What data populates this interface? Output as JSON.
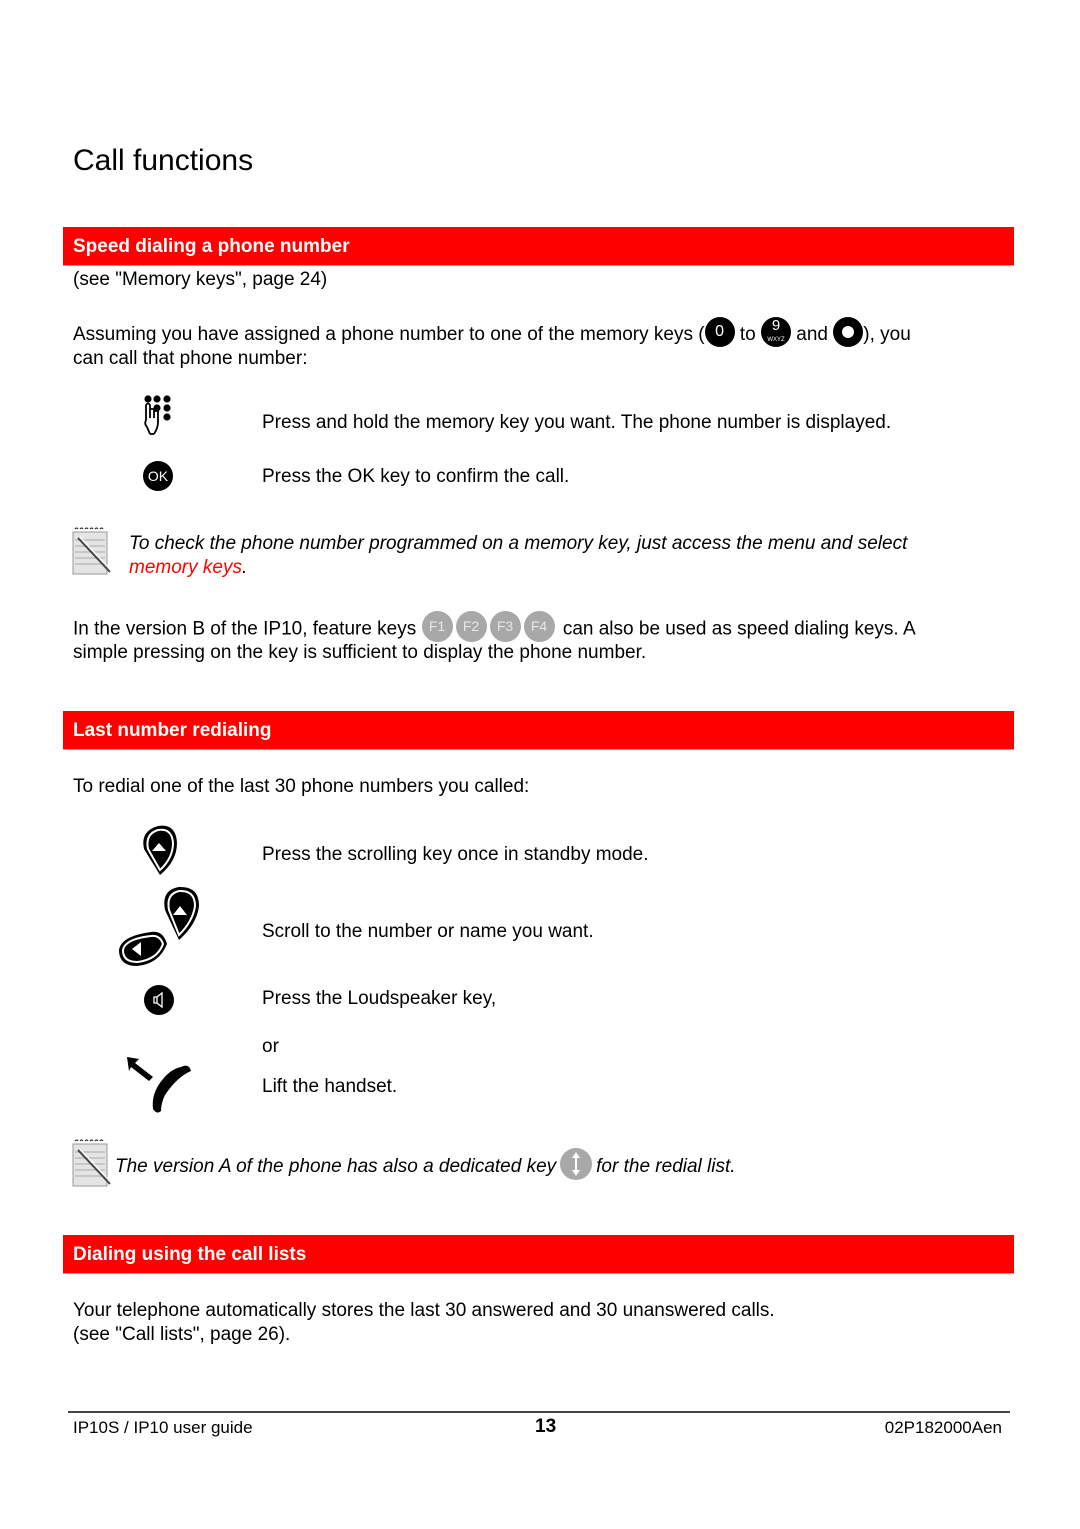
{
  "page": {
    "title": "Call functions"
  },
  "sections": {
    "speed_dialing": {
      "heading": "Speed dialing a phone number",
      "reference": "(see \"Memory keys\", page 24)",
      "intro_before_keys": "Assuming you have assigned a phone number to one of the memory keys (",
      "key_from": "0",
      "to_word": "to",
      "key_to": "9",
      "key_to_letters": "WXYZ",
      "and_word": "and",
      "intro_after_keys": "), you",
      "intro_line2": "can call that phone number:",
      "steps": [
        {
          "icon": "hand-keypad-icon",
          "text": "Press and hold the memory key you want. The phone number is displayed."
        },
        {
          "icon": "ok-key-icon",
          "icon_label": "OK",
          "text": "Press the OK key to confirm the call."
        }
      ],
      "note": {
        "text": "To check the phone number programmed on a memory key, just access the menu and select",
        "link": "memory keys",
        "end": "."
      },
      "version_b_before": "In the version B of the IP10, feature keys",
      "feature_keys": [
        "F1",
        "F2",
        "F3",
        "F4"
      ],
      "version_b_after": "can also be used as speed dialing keys. A",
      "version_b_line2": "simple pressing on the key is sufficient to display the phone number."
    },
    "last_number_redialing": {
      "heading": "Last number redialing",
      "intro": "To redial one of the last 30 phone numbers you called:",
      "steps": [
        {
          "icon": "scroll-up-key-icon",
          "text": "Press the scrolling key once in standby mode."
        },
        {
          "icon": "scroll-keys-icon",
          "text": "Scroll to the number or name you want."
        },
        {
          "icon": "loudspeaker-key-icon",
          "text": "Press the Loudspeaker key,"
        },
        {
          "icon": "",
          "text": "or"
        },
        {
          "icon": "lift-handset-icon",
          "text": "Lift the handset."
        }
      ],
      "note": {
        "before": "The version A of the phone has also a dedicated key",
        "after": "for the redial list."
      }
    },
    "call_lists": {
      "heading": "Dialing using the call lists",
      "line1": "Your telephone automatically stores the last 30 answered and 30 unanswered calls.",
      "line2": "(see \"Call lists\", page 26)."
    }
  },
  "footer": {
    "left": "IP10S / IP10 user guide",
    "page_number": "13",
    "right": "02P182000Aen"
  },
  "colors": {
    "section_bar": "#ff0000",
    "link": "#ff0000",
    "feature_key": "#a8a8a8"
  }
}
